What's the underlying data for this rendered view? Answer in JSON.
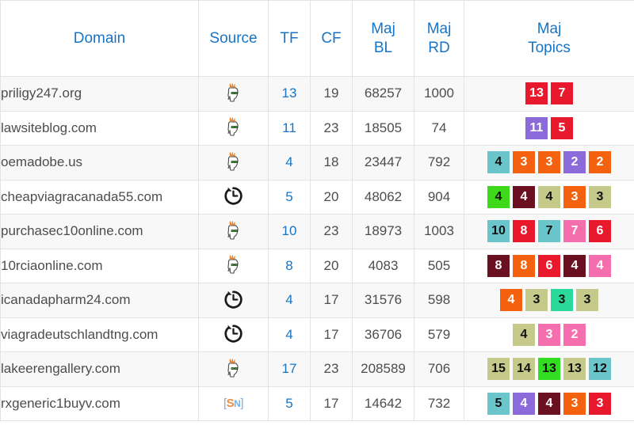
{
  "table": {
    "columns": [
      {
        "key": "domain",
        "label": "Domain"
      },
      {
        "key": "source",
        "label": "Source"
      },
      {
        "key": "tf",
        "label": "TF"
      },
      {
        "key": "cf",
        "label": "CF"
      },
      {
        "key": "bl",
        "label_top": "Maj",
        "label_bottom": "BL"
      },
      {
        "key": "rd",
        "label_top": "Maj",
        "label_bottom": "RD"
      },
      {
        "key": "topics",
        "label_top": "Maj",
        "label_bottom": "Topics"
      }
    ],
    "header_color": "#1874c4",
    "rows": [
      {
        "domain": "priligy247.org",
        "source": "majestic-flaming-head-icon",
        "tf": "13",
        "cf": "19",
        "bl": "68257",
        "rd": "1000",
        "topics": [
          {
            "value": "13",
            "bg": "#e8192c",
            "fg": "#ffffff"
          },
          {
            "value": "7",
            "bg": "#e8192c",
            "fg": "#ffffff"
          }
        ]
      },
      {
        "domain": "lawsiteblog.com",
        "source": "majestic-flaming-head-icon",
        "tf": "11",
        "cf": "23",
        "bl": "18505",
        "rd": "74",
        "topics": [
          {
            "value": "11",
            "bg": "#8b6bd9",
            "fg": "#ffffff"
          },
          {
            "value": "5",
            "bg": "#e8192c",
            "fg": "#ffffff"
          }
        ]
      },
      {
        "domain": "oemadobe.us",
        "source": "majestic-flaming-head-icon",
        "tf": "4",
        "cf": "18",
        "bl": "23447",
        "rd": "792",
        "topics": [
          {
            "value": "4",
            "bg": "#6bc6cc",
            "fg": "#111111"
          },
          {
            "value": "3",
            "bg": "#f4620f",
            "fg": "#ffffff"
          },
          {
            "value": "3",
            "bg": "#f4620f",
            "fg": "#ffffff"
          },
          {
            "value": "2",
            "bg": "#8b6bd9",
            "fg": "#ffffff"
          },
          {
            "value": "2",
            "bg": "#f4620f",
            "fg": "#ffffff"
          }
        ]
      },
      {
        "domain": "cheapviagracanada55.com",
        "source": "clock-icon",
        "tf": "5",
        "cf": "20",
        "bl": "48062",
        "rd": "904",
        "topics": [
          {
            "value": "4",
            "bg": "#3fd91b",
            "fg": "#111111"
          },
          {
            "value": "4",
            "bg": "#6b1020",
            "fg": "#ffffff"
          },
          {
            "value": "4",
            "bg": "#c5c98a",
            "fg": "#111111"
          },
          {
            "value": "3",
            "bg": "#f4620f",
            "fg": "#ffffff"
          },
          {
            "value": "3",
            "bg": "#c5c98a",
            "fg": "#111111"
          }
        ]
      },
      {
        "domain": "purchasec10online.com",
        "source": "majestic-flaming-head-icon",
        "tf": "10",
        "cf": "23",
        "bl": "18973",
        "rd": "1003",
        "topics": [
          {
            "value": "10",
            "bg": "#6bc6cc",
            "fg": "#111111"
          },
          {
            "value": "8",
            "bg": "#e8192c",
            "fg": "#ffffff"
          },
          {
            "value": "7",
            "bg": "#6bc6cc",
            "fg": "#111111"
          },
          {
            "value": "7",
            "bg": "#f56fae",
            "fg": "#ffffff"
          },
          {
            "value": "6",
            "bg": "#e8192c",
            "fg": "#ffffff"
          }
        ]
      },
      {
        "domain": "10rciaonline.com",
        "source": "majestic-flaming-head-icon",
        "tf": "8",
        "cf": "20",
        "bl": "4083",
        "rd": "505",
        "topics": [
          {
            "value": "8",
            "bg": "#6b1020",
            "fg": "#ffffff"
          },
          {
            "value": "8",
            "bg": "#f4620f",
            "fg": "#ffffff"
          },
          {
            "value": "6",
            "bg": "#e8192c",
            "fg": "#ffffff"
          },
          {
            "value": "4",
            "bg": "#6b1020",
            "fg": "#ffffff"
          },
          {
            "value": "4",
            "bg": "#f56fae",
            "fg": "#ffffff"
          }
        ]
      },
      {
        "domain": "icanadapharm24.com",
        "source": "clock-icon",
        "tf": "4",
        "cf": "17",
        "bl": "31576",
        "rd": "598",
        "topics": [
          {
            "value": "4",
            "bg": "#f4620f",
            "fg": "#ffffff"
          },
          {
            "value": "3",
            "bg": "#c5c98a",
            "fg": "#111111"
          },
          {
            "value": "3",
            "bg": "#2bd99a",
            "fg": "#111111"
          },
          {
            "value": "3",
            "bg": "#c5c98a",
            "fg": "#111111"
          }
        ]
      },
      {
        "domain": "viagradeutschlandtng.com",
        "source": "clock-icon",
        "tf": "4",
        "cf": "17",
        "bl": "36706",
        "rd": "579",
        "topics": [
          {
            "value": "4",
            "bg": "#c5c98a",
            "fg": "#111111"
          },
          {
            "value": "3",
            "bg": "#f56fae",
            "fg": "#ffffff"
          },
          {
            "value": "2",
            "bg": "#f56fae",
            "fg": "#ffffff"
          }
        ]
      },
      {
        "domain": "lakeerengallery.com",
        "source": "majestic-flaming-head-icon",
        "tf": "17",
        "cf": "23",
        "bl": "208589",
        "rd": "706",
        "topics": [
          {
            "value": "15",
            "bg": "#c5c98a",
            "fg": "#111111"
          },
          {
            "value": "14",
            "bg": "#c5c98a",
            "fg": "#111111"
          },
          {
            "value": "13",
            "bg": "#33dd22",
            "fg": "#111111"
          },
          {
            "value": "13",
            "bg": "#c5c98a",
            "fg": "#111111"
          },
          {
            "value": "12",
            "bg": "#6bc6cc",
            "fg": "#111111"
          }
        ]
      },
      {
        "domain": "rxgeneric1buyv.com",
        "source": "sn-icon",
        "tf": "5",
        "cf": "17",
        "bl": "14642",
        "rd": "732",
        "topics": [
          {
            "value": "5",
            "bg": "#6bc6cc",
            "fg": "#111111"
          },
          {
            "value": "4",
            "bg": "#8b6bd9",
            "fg": "#ffffff"
          },
          {
            "value": "4",
            "bg": "#6b1020",
            "fg": "#ffffff"
          },
          {
            "value": "3",
            "bg": "#f4620f",
            "fg": "#ffffff"
          },
          {
            "value": "3",
            "bg": "#e8192c",
            "fg": "#ffffff"
          }
        ]
      }
    ],
    "sn_icon": {
      "bracket_left": "[",
      "s": "S",
      "n": "N",
      "bracket_right": "]"
    }
  }
}
